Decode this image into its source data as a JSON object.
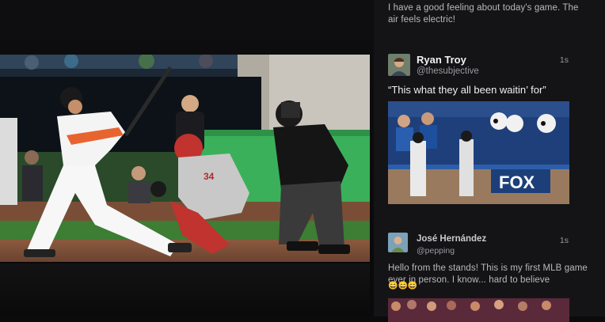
{
  "feed": {
    "top_text": "I have a good feeling about today's game. The air feels electric!",
    "tweets": [
      {
        "name": "Ryan Troy",
        "handle": "@thesubjective",
        "time": "1s",
        "text": "“This what they all been waitin’ for”"
      },
      {
        "name": "José Hernández",
        "handle": "@pepping",
        "time": "1s",
        "text": "Hello from the stands! This is my first MLB game ever in person. I know... hard to believe",
        "emojis": "😄😄😄"
      }
    ]
  },
  "photo_overlays": {
    "fox_logo": "FOX"
  },
  "colors": {
    "background": "#0b0b0c",
    "feed_background": "#141416",
    "text_primary": "#f2f2f2",
    "text_secondary": "#9a9aa0"
  }
}
